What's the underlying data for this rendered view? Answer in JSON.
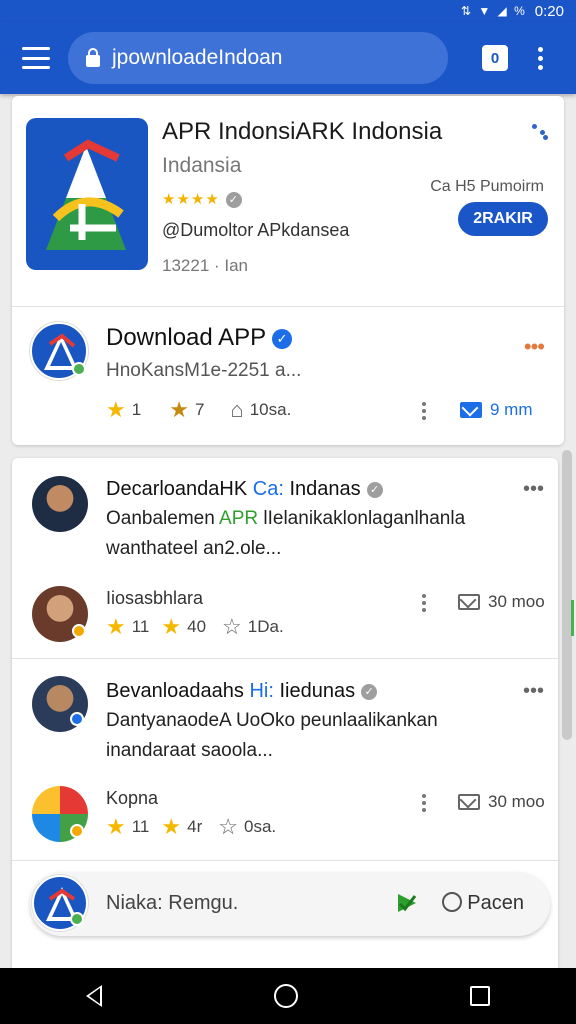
{
  "status_bar": {
    "time": "0:20",
    "icons": "⇅ ▼ ◢ %"
  },
  "browser": {
    "url": "jpownloadeIndoan",
    "tab_count": "0"
  },
  "app_card": {
    "title": "APR IndonsiARK Indonsia",
    "subtitle": "Indansia",
    "stars": "★★★★",
    "developer": "@Dumoltor APkdansea",
    "date": "13221 · Ian",
    "price_label": "Ca H5 Pumoirm",
    "action_label": "2RAKIR"
  },
  "download_row": {
    "title": "Download APP",
    "subtitle": "HnoKansM1e-2251 a...",
    "stat1": "1",
    "stat2": "7",
    "stat3": "10sa.",
    "count": "9 mm"
  },
  "posts": [
    {
      "title": "DecarloandaHK",
      "title_tail": "Indanas",
      "title_highlight": "Ca:",
      "body_lead": "Oanbalemen",
      "body_green": "APR",
      "body_rest": "lIelanikaklonlaganlhanla",
      "body_line2": "wanthateel an2.ole...",
      "reply_name": "Iiosasbhlara",
      "r1": "11",
      "r2": "40",
      "r3": "1Da.",
      "count": "30 moo"
    },
    {
      "title": "Bevanloadaahs",
      "title_tail": "Iiedunas",
      "title_highlight": "Hi:",
      "body_line1": "DantyanaodeA UoOko peunlaalikankan",
      "body_line2": "inandaraat saoola...",
      "reply_name": "Kopna",
      "r1": "11",
      "r2": "4r",
      "r3": "0sa.",
      "count": "30 moo"
    }
  ],
  "bottom_bar": {
    "field_text": "Niaka: Remgu.",
    "open_label": "Pacen"
  },
  "colors": {
    "primary": "#1b56c9",
    "accent_green": "#2e9e2e",
    "star": "#f5b800",
    "verified": "#1b6ee8"
  }
}
